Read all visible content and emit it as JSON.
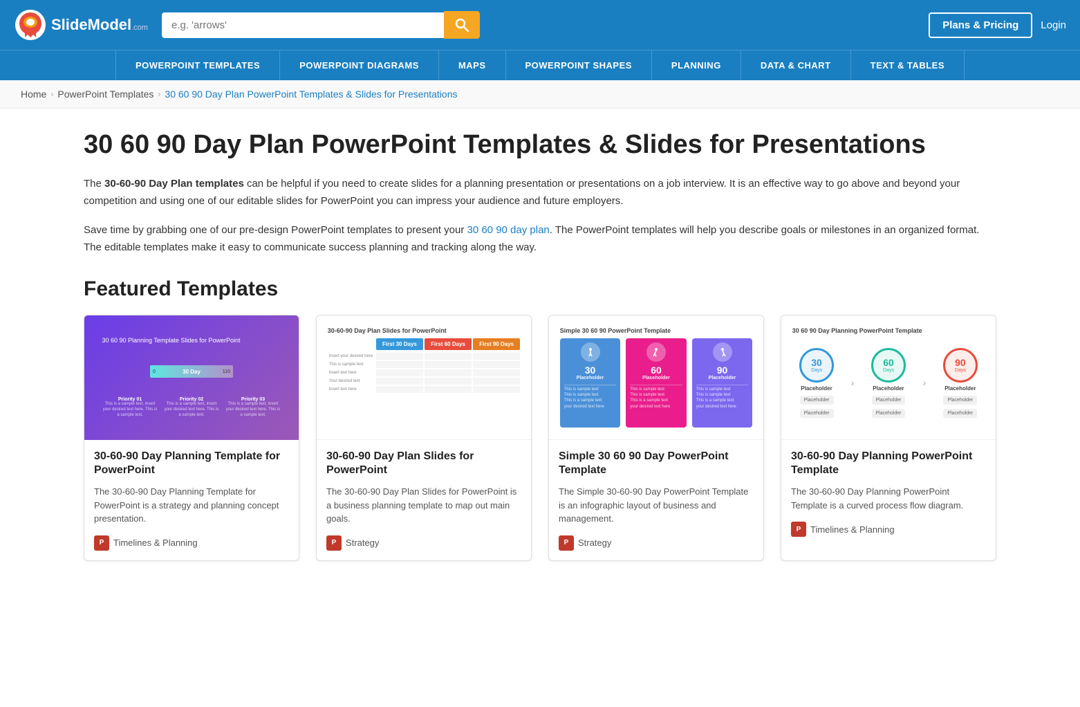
{
  "header": {
    "logo_text": "SlideModel",
    "logo_com": ".com",
    "search_placeholder": "e.g. 'arrows'",
    "plans_button": "Plans & Pricing",
    "login_button": "Login"
  },
  "nav": {
    "items": [
      "POWERPOINT TEMPLATES",
      "POWERPOINT DIAGRAMS",
      "MAPS",
      "POWERPOINT SHAPES",
      "PLANNING",
      "DATA & CHART",
      "TEXT & TABLES"
    ]
  },
  "breadcrumb": {
    "home": "Home",
    "parent": "PowerPoint Templates",
    "current": "30 60 90 Day Plan PowerPoint Templates & Slides for Presentations"
  },
  "page": {
    "title": "30 60 90 Day Plan PowerPoint Templates & Slides for Presentations",
    "desc1_before": "The ",
    "desc1_bold": "30-60-90 Day Plan templates",
    "desc1_after": " can be helpful if you need to create slides for a planning presentation or presentations on a job interview. It is an effective way to go above and beyond your competition and using one of our editable slides for PowerPoint you can impress your audience and future employers.",
    "desc2_before": "Save time by grabbing one of our pre-design PowerPoint templates to present your ",
    "desc2_link": "30 60 90 day plan",
    "desc2_after": ". The PowerPoint templates will help you describe goals or milestones in an organized format. The editable templates make it easy to communicate success planning and tracking along the way.",
    "featured_title": "Featured Templates"
  },
  "cards": [
    {
      "title": "30-60-90 Day Planning Template for PowerPoint",
      "desc": "The 30-60-90 Day Planning Template for PowerPoint is a strategy and planning concept presentation.",
      "tag": "Timelines & Planning",
      "img_label": "30 60 90 Planning Template Slides for PowerPoint"
    },
    {
      "title": "30-60-90 Day Plan Slides for PowerPoint",
      "desc": "The 30-60-90 Day Plan Slides for PowerPoint is a business planning template to map out main goals.",
      "tag": "Strategy",
      "img_label": "30-60-90 Day Plan Slides for PowerPoint"
    },
    {
      "title": "Simple 30 60 90 Day PowerPoint Template",
      "desc": "The Simple 30-60-90 Day PowerPoint Template is an infographic layout of business and management.",
      "tag": "Strategy",
      "img_label": "Simple 30 60 90 PowerPoint Template"
    },
    {
      "title": "30-60-90 Day Planning PowerPoint Template",
      "desc": "The 30-60-90 Day Planning PowerPoint Template is a curved process flow diagram.",
      "tag": "Timelines & Planning",
      "img_label": "30 60 90 Day Planning PowerPoint Template"
    }
  ],
  "colors": {
    "brand_blue": "#1a7fc1",
    "accent_orange": "#f5a623",
    "ppt_red": "#c0392b"
  }
}
